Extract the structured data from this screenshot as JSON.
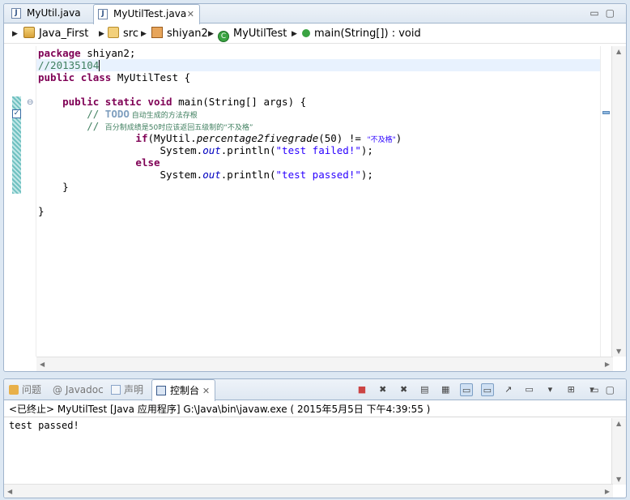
{
  "editor": {
    "tabs": [
      {
        "label": "MyUtil.java",
        "active": false
      },
      {
        "label": "MyUtilTest.java",
        "active": true
      }
    ],
    "tab_close": "✕",
    "breadcrumb": [
      "Java_First",
      "src",
      "shiyan2",
      "MyUtilTest",
      "main(String[]) : void"
    ],
    "code": {
      "l1_kw": "package",
      "l1_rest": " shiyan2;",
      "l2": "//20135104",
      "l3_kw1": "public",
      "l3_kw2": "class",
      "l3_rest": " MyUtilTest {",
      "l5_kw1": "public",
      "l5_kw2": "static",
      "l5_kw3": "void",
      "l5_rest": " main(String[] args) {",
      "l6_prefix": "// ",
      "l6_task": "TODO",
      "l6_text": " 自动生成的方法存根",
      "l7_prefix": "// ",
      "l7_text": "百分制成绩是50时应该返回五级制的“不及格”",
      "l8_kw": "if",
      "l8_a": "(MyUtil.",
      "l8_method": "percentage2fivegrade",
      "l8_b": "(50) != ",
      "l8_str": "\"不及格\"",
      "l8_c": ")",
      "l9_a": "System.",
      "l9_out": "out",
      "l9_b": ".println(",
      "l9_str": "\"test failed!\"",
      "l9_c": ");",
      "l10_kw": "else",
      "l11_a": "System.",
      "l11_out": "out",
      "l11_b": ".println(",
      "l11_str": "\"test passed!\"",
      "l11_c": ");",
      "l12": "}",
      "l14": "}"
    }
  },
  "console": {
    "tabs": [
      {
        "label": "问题",
        "active": false
      },
      {
        "label": "@ Javadoc",
        "active": false
      },
      {
        "label": "声明",
        "active": false
      },
      {
        "label": "控制台",
        "active": true
      }
    ],
    "status": "<已终止> MyUtilTest [Java 应用程序] G:\\Java\\bin\\javaw.exe ( 2015年5月5日 下午4:39:55 )",
    "output": "test passed!"
  },
  "colors": {
    "keyword": "#7f0055",
    "comment": "#3f7f5f",
    "string": "#2a00ff",
    "field": "#0000c0",
    "current_line": "#e8f2fe"
  }
}
